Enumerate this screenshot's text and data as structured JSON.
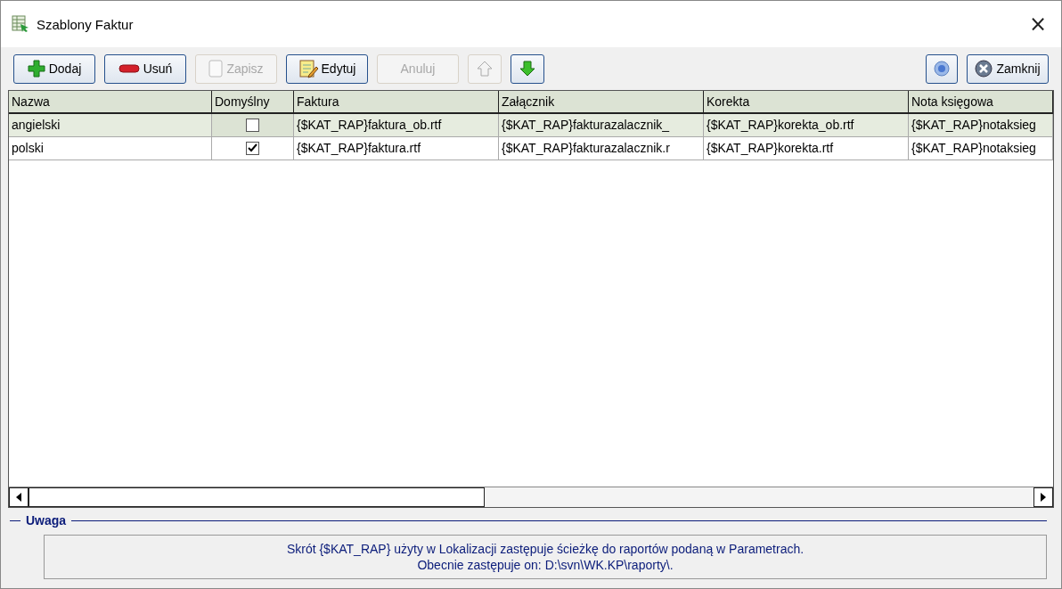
{
  "window": {
    "title": "Szablony Faktur",
    "close": "×"
  },
  "toolbar": [
    {
      "kind": "text",
      "label": "Dodaj",
      "disabled": false
    },
    {
      "kind": "text",
      "label": "Usuń",
      "disabled": false
    },
    {
      "kind": "text",
      "label": "Zapisz",
      "disabled": true
    },
    {
      "kind": "text",
      "label": "Edytuj",
      "disabled": false
    },
    {
      "kind": "text",
      "label": "Anuluj",
      "disabled": true
    },
    {
      "kind": "icon",
      "disabled": true
    },
    {
      "kind": "icon",
      "disabled": false
    }
  ],
  "toolbar_right": [
    {
      "kind": "icon",
      "disabled": false
    },
    {
      "kind": "text",
      "label": "Zamknij",
      "disabled": false
    }
  ],
  "table": {
    "columns": [
      "Nazwa",
      "Domyślny",
      "Faktura",
      "Załącznik",
      "Korekta",
      "Nota księgowa"
    ],
    "rows": [
      {
        "selected": true,
        "default": false,
        "cells": [
          "angielski",
          "",
          "{$KAT_RAP}faktura_ob.rtf",
          "{$KAT_RAP}fakturazalacznik_",
          "{$KAT_RAP}korekta_ob.rtf",
          "{$KAT_RAP}notaksieg"
        ]
      },
      {
        "selected": false,
        "default": true,
        "cells": [
          "polski",
          "",
          "{$KAT_RAP}faktura.rtf",
          "{$KAT_RAP}fakturazalacznik.r",
          "{$KAT_RAP}korekta.rtf",
          "{$KAT_RAP}notaksieg"
        ]
      }
    ]
  },
  "note": {
    "title": "Uwaga",
    "lines": [
      "Skrót {$KAT_RAP} użyty w Lokalizacji zastępuje ścieżkę do raportów podaną w Parametrach.",
      "Obecnie zastępuje on: D:\\svn\\WK.KP\\raporty\\."
    ]
  }
}
